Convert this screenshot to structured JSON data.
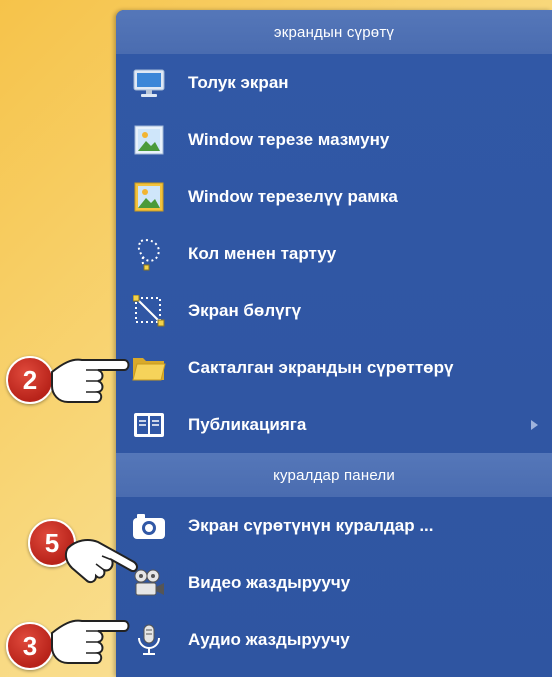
{
  "menu": {
    "section1_title": "экрандын сүрөтү",
    "items1": [
      {
        "label": "Толук экран",
        "icon": "monitor-icon"
      },
      {
        "label": "Window терезе мазмуну",
        "icon": "image-icon"
      },
      {
        "label": "Window терезелүү рамка",
        "icon": "framed-image-icon"
      },
      {
        "label": "Кол менен тартуу",
        "icon": "lasso-icon"
      },
      {
        "label": "Экран бөлүгү",
        "icon": "region-select-icon"
      },
      {
        "label": "Сакталган экрандын сүрөттөрү",
        "icon": "folder-icon"
      },
      {
        "label": "Публикацияга",
        "icon": "book-icon",
        "submenu": true
      }
    ],
    "section2_title": "куралдар панели",
    "items2": [
      {
        "label": "Экран сүрөтүнүн куралдар ...",
        "icon": "camera-icon"
      },
      {
        "label": "Видео жаздыруучу",
        "icon": "video-camera-icon"
      },
      {
        "label": "Аудио жаздыруучу",
        "icon": "microphone-icon"
      }
    ]
  },
  "annotations": [
    {
      "number": "2",
      "target": "Сакталган экрандын сүрөттөрү"
    },
    {
      "number": "5",
      "target": "Экран сүрөтүнүн куралдар ..."
    },
    {
      "number": "3",
      "target": "Аудио жаздыруучу"
    }
  ],
  "colors": {
    "menu_bg": "#3158a6",
    "header_bg": "#4f70b3",
    "background": "#f8d77a",
    "badge": "#c8291e"
  }
}
